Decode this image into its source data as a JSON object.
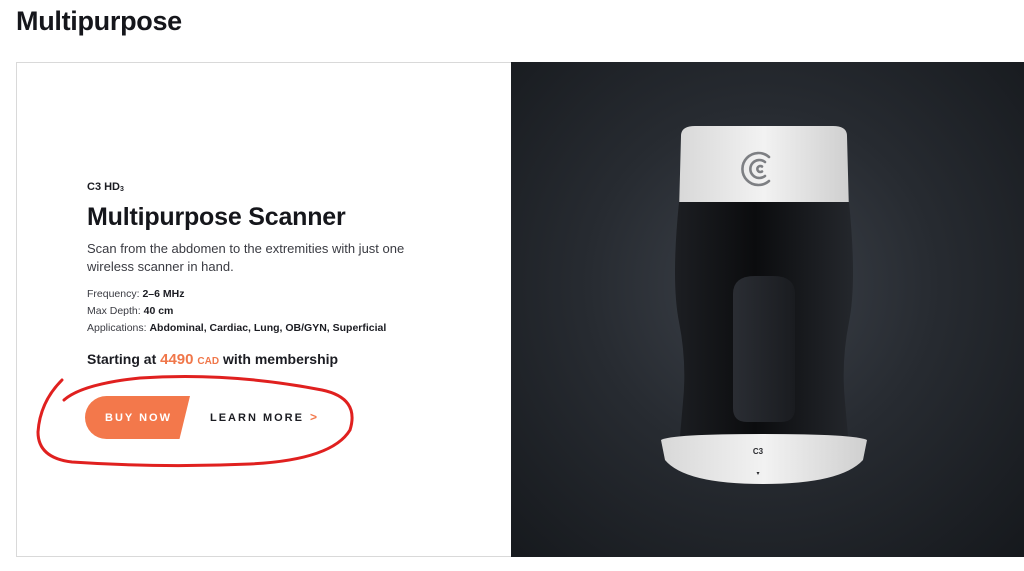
{
  "page": {
    "heading": "Multipurpose"
  },
  "product": {
    "model": "C3 HD",
    "model_sub": "3",
    "title": "Multipurpose Scanner",
    "description": "Scan from the abdomen to the extremities with just one wireless scanner in hand.",
    "specs": [
      {
        "label": "Frequency: ",
        "value": "2–6 MHz"
      },
      {
        "label": "Max Depth: ",
        "value": "40 cm"
      },
      {
        "label": "Applications: ",
        "value": "Abdominal, Cardiac, Lung, OB/GYN, Superficial"
      }
    ],
    "price": {
      "prefix": "Starting at",
      "amount": "4490",
      "currency": "CAD",
      "suffix": "with membership"
    },
    "device_label": "C3"
  },
  "actions": {
    "buy_label": "BUY NOW",
    "learn_label": "LEARN MORE",
    "learn_chevron": ">"
  },
  "colors": {
    "accent": "#f3784b",
    "annotation": "#e0201f",
    "panel_bg": "#272b31",
    "device_white": "#ececec",
    "device_black": "#0d0e10"
  },
  "icons": {
    "brand_logo": "clarius-c-logo-icon",
    "learn_chevron": "chevron-right-icon",
    "circle_annotation": "hand-drawn-circle-annotation"
  }
}
